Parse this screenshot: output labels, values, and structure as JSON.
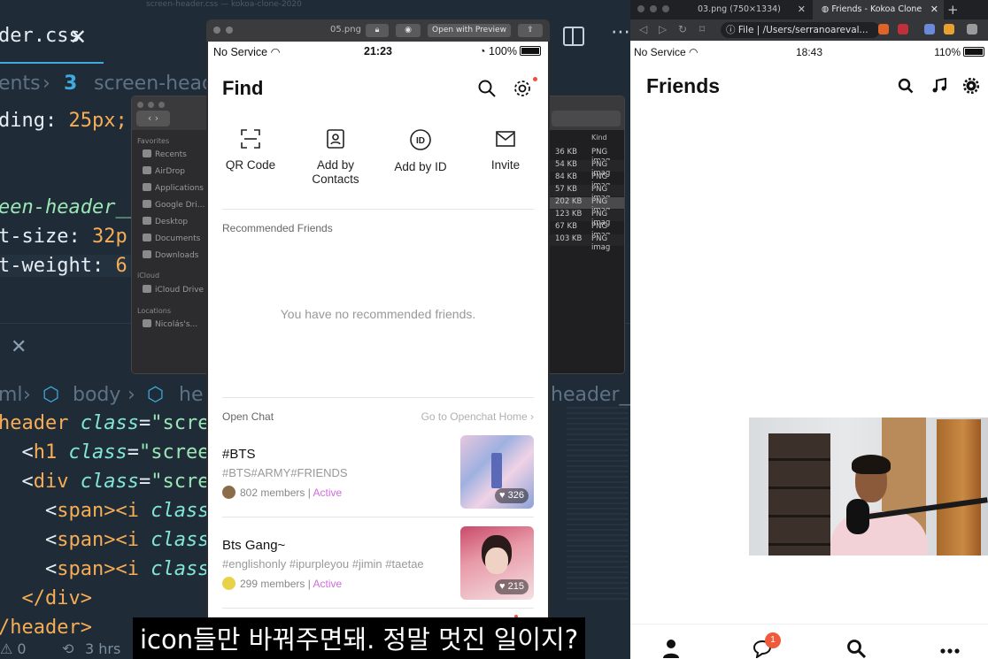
{
  "editor": {
    "file_tab": "der.css",
    "tab_close": "✕",
    "breadcrumb_top": [
      "ents",
      "screen-head"
    ],
    "css_lines": [
      {
        "prop": "ding",
        "value": "25px;"
      },
      {
        "selector": "een-header__"
      },
      {
        "prop": "t-size",
        "value": "32p"
      },
      {
        "prop": "t-weight",
        "value": "6"
      }
    ],
    "breadcrumb_html": [
      "ml",
      "body",
      "he"
    ],
    "html_lines": [
      {
        "tag": "header",
        "attr": "class",
        "str": "\"scre"
      },
      {
        "tag": "h1",
        "attr": "class",
        "str": "\"screer"
      },
      {
        "tag": "div",
        "attr": "class",
        "str": "\"scree"
      },
      {
        "tag": "span><i",
        "attr": "class"
      },
      {
        "tag": "span><i",
        "attr": "class"
      },
      {
        "tag": "span><i",
        "attr": "class"
      },
      {
        "close": "</div>"
      },
      {
        "close": "/header>"
      }
    ],
    "right_crumb": "header__i",
    "status": "⚠ 0",
    "status_time": "3 hrs",
    "window_caption": "screen-header.css — kokoa-clone-2020"
  },
  "finder": {
    "nav_label": "‹ ›",
    "favorites_heading": "Favorites",
    "favorites": [
      "Recents",
      "AirDrop",
      "Applications",
      "Google Dri...",
      "Desktop",
      "Documents",
      "Downloads"
    ],
    "icloud_heading": "iCloud",
    "icloud": [
      "iCloud Drive"
    ],
    "locations_heading": "Locations",
    "locations": [
      "Nicolás's..."
    ],
    "kind_header": "Kind",
    "rows": [
      {
        "size": "36 KB",
        "kind": "PNG imag"
      },
      {
        "size": "54 KB",
        "kind": "PNG imag"
      },
      {
        "size": "84 KB",
        "kind": "PNG imag"
      },
      {
        "size": "57 KB",
        "kind": "PNG imag"
      },
      {
        "size": "202 KB",
        "kind": "PNG imag"
      },
      {
        "size": "123 KB",
        "kind": "PNG imag"
      },
      {
        "size": "67 KB",
        "kind": "PNG imag"
      },
      {
        "size": "103 KB",
        "kind": "PNG imag"
      }
    ]
  },
  "simulator": {
    "title": "05.png",
    "open_preview": "Open with Preview",
    "status": {
      "carrier": "No Service",
      "time": "21:23",
      "battery": "100%"
    },
    "page_title": "Find",
    "options": [
      {
        "label": "QR Code",
        "icon": "qr-scan-icon"
      },
      {
        "label": "Add by Contacts",
        "icon": "contacts-icon"
      },
      {
        "label": "Add by ID",
        "icon": "id-icon"
      },
      {
        "label": "Invite",
        "icon": "mail-icon"
      }
    ],
    "recommended_title": "Recommended Friends",
    "empty_text": "You have no recommended friends.",
    "open_chat_title": "Open Chat",
    "go_to_openchat": "Go to Openchat Home ›",
    "rooms": [
      {
        "name": "#BTS",
        "tags": "#BTS#ARMY#FRIENDS",
        "members": "802 members",
        "state": "Active",
        "likes": "326"
      },
      {
        "name": "Bts Gang~",
        "tags": "#englishonly #ipurpleyou #jimin #taetae",
        "members": "299 members",
        "state": "Active",
        "likes": "215"
      }
    ],
    "accent_color": "#d26adf",
    "notify_color": "#f0503a"
  },
  "browser": {
    "tabs": [
      {
        "label": "03.png (750×1334)",
        "close": "✕"
      },
      {
        "label": "Friends - Kokoa Clone",
        "close": "✕"
      }
    ],
    "new_tab": "+",
    "url_scheme": "File",
    "url": "/Users/serranoareval...",
    "status": {
      "carrier": "No Service",
      "time": "18:43",
      "battery": "110%"
    },
    "page_title": "Friends",
    "header_icons": [
      "search-icon",
      "music-note-icon",
      "gear-icon"
    ],
    "bottom_icons": [
      "user-icon",
      "chat-icon",
      "search-icon",
      "more-icon"
    ],
    "chat_badge": "1",
    "badge_color": "#f05a3a"
  },
  "subtitle": "icon들만 바꿔주면돼. 정말 멋진 일이지?"
}
